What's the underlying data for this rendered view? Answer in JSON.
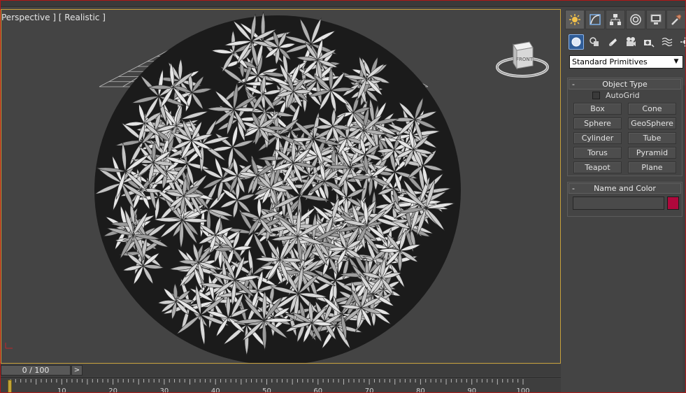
{
  "viewport": {
    "label": "Perspective ] [ Realistic ]",
    "viewcube_label": "FRONT"
  },
  "timeline": {
    "frame_display": "0 / 100",
    "next_button": ">",
    "current_frame": 0,
    "total_frames": 100,
    "ruler_labels": [
      "10",
      "20",
      "30",
      "40",
      "50",
      "60",
      "70",
      "80",
      "90",
      "100"
    ]
  },
  "command_panel": {
    "tabs": [
      "create-tab",
      "modify-tab",
      "hierarchy-tab",
      "motion-tab",
      "display-tab",
      "utilities-tab"
    ],
    "subcategory_icons": [
      "geometry-icon",
      "shapes-icon",
      "lights-icon",
      "cameras-icon",
      "helpers-icon",
      "space-warps-icon",
      "systems-icon"
    ],
    "category_dropdown": "Standard Primitives",
    "object_type": {
      "title": "Object Type",
      "collapse_symbol": "-",
      "autogrid_label": "AutoGrid",
      "buttons": [
        "Box",
        "Cone",
        "Sphere",
        "GeoSphere",
        "Cylinder",
        "Tube",
        "Torus",
        "Pyramid",
        "Teapot",
        "Plane"
      ]
    },
    "name_and_color": {
      "title": "Name and Color",
      "collapse_symbol": "-",
      "name_value": "",
      "color": "#b0083c"
    }
  },
  "colors": {
    "viewport_border": "#c8a13c",
    "window_border": "#b01818",
    "active_tab": "#2f5c97"
  }
}
